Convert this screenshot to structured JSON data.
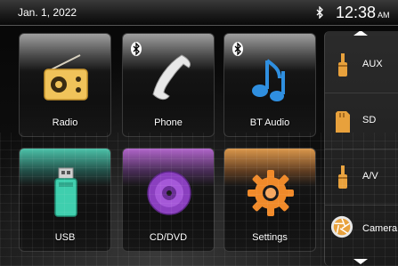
{
  "status": {
    "date": "Jan. 1, 2022",
    "time": "12:38",
    "ampm": "AM",
    "bluetooth_icon": "bluetooth-icon"
  },
  "tiles": [
    {
      "label": "Radio",
      "icon": "radio-icon"
    },
    {
      "label": "Phone",
      "icon": "phone-icon"
    },
    {
      "label": "BT Audio",
      "icon": "music-note-icon"
    },
    {
      "label": "USB",
      "icon": "usb-drive-icon"
    },
    {
      "label": "CD/DVD",
      "icon": "disc-icon"
    },
    {
      "label": "Settings",
      "icon": "gear-icon"
    }
  ],
  "sources": [
    {
      "label": "AUX",
      "icon": "aux-plug-icon"
    },
    {
      "label": "SD",
      "icon": "sd-card-icon"
    },
    {
      "label": "A/V",
      "icon": "av-plug-icon"
    },
    {
      "label": "Camera",
      "icon": "camera-aperture-icon"
    }
  ],
  "colors": {
    "usb_accent": "#3fcfae",
    "cddvd_accent": "#b96be0",
    "settings_accent": "#f08a2a",
    "radio_accent": "#f0c35a",
    "bt_accent": "#2f8fe0"
  }
}
